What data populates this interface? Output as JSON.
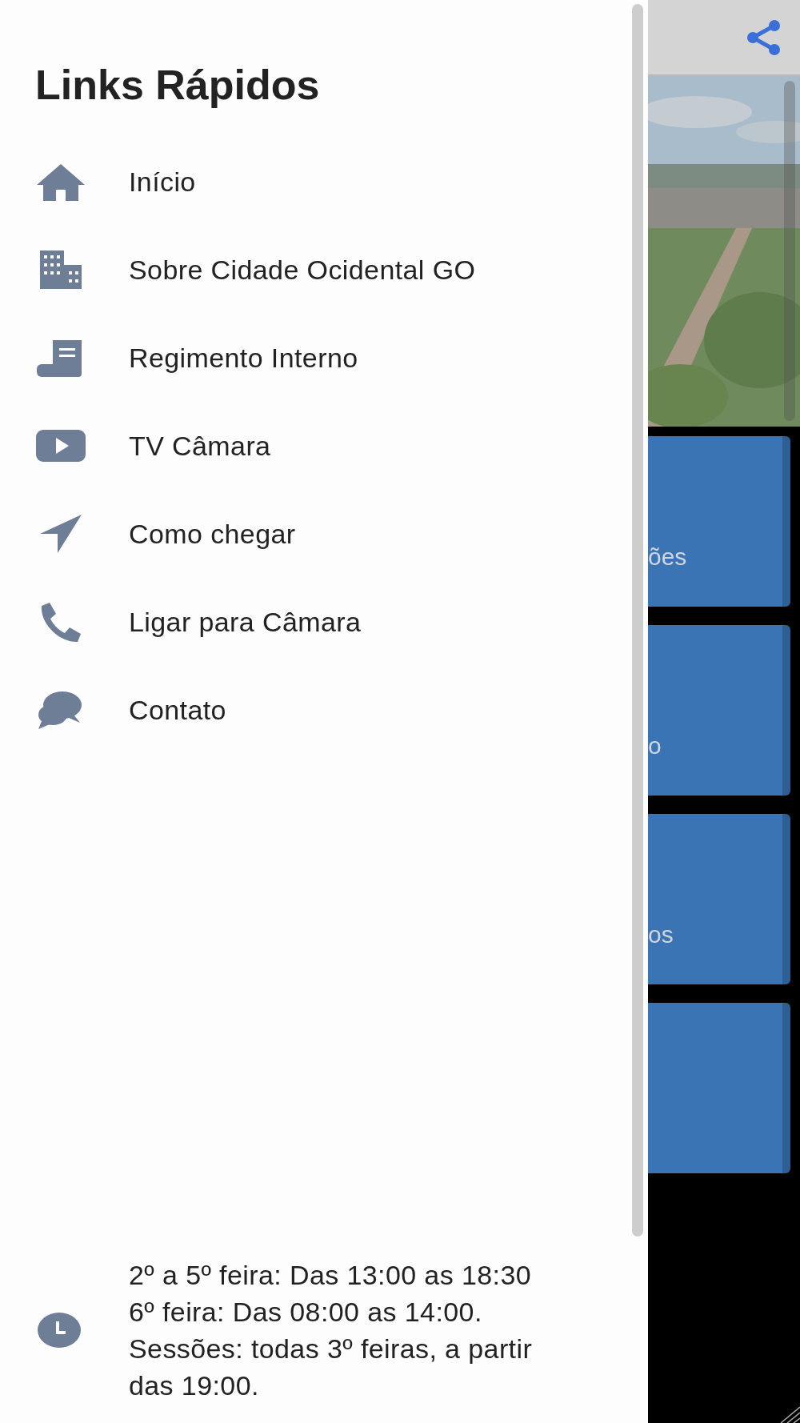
{
  "drawer": {
    "title": "Links Rápidos",
    "items": [
      {
        "label": "Início"
      },
      {
        "label": "Sobre Cidade Ocidental GO"
      },
      {
        "label": "Regimento Interno"
      },
      {
        "label": "TV Câmara"
      },
      {
        "label": "Como chegar"
      },
      {
        "label": "Ligar para Câmara"
      },
      {
        "label": "Contato"
      }
    ],
    "hours": [
      "2º a 5º feira: Das 13:00 as 18:30",
      "6º feira: Das 08:00 as 14:00.",
      "Sessões: todas 3º feiras, a partir das 19:00."
    ]
  },
  "background": {
    "tiles": [
      {
        "kind": "tile",
        "label": "ões"
      },
      {
        "kind": "tile",
        "label": "o"
      },
      {
        "kind": "tile",
        "label": "os"
      },
      {
        "kind": "tile"
      }
    ]
  }
}
